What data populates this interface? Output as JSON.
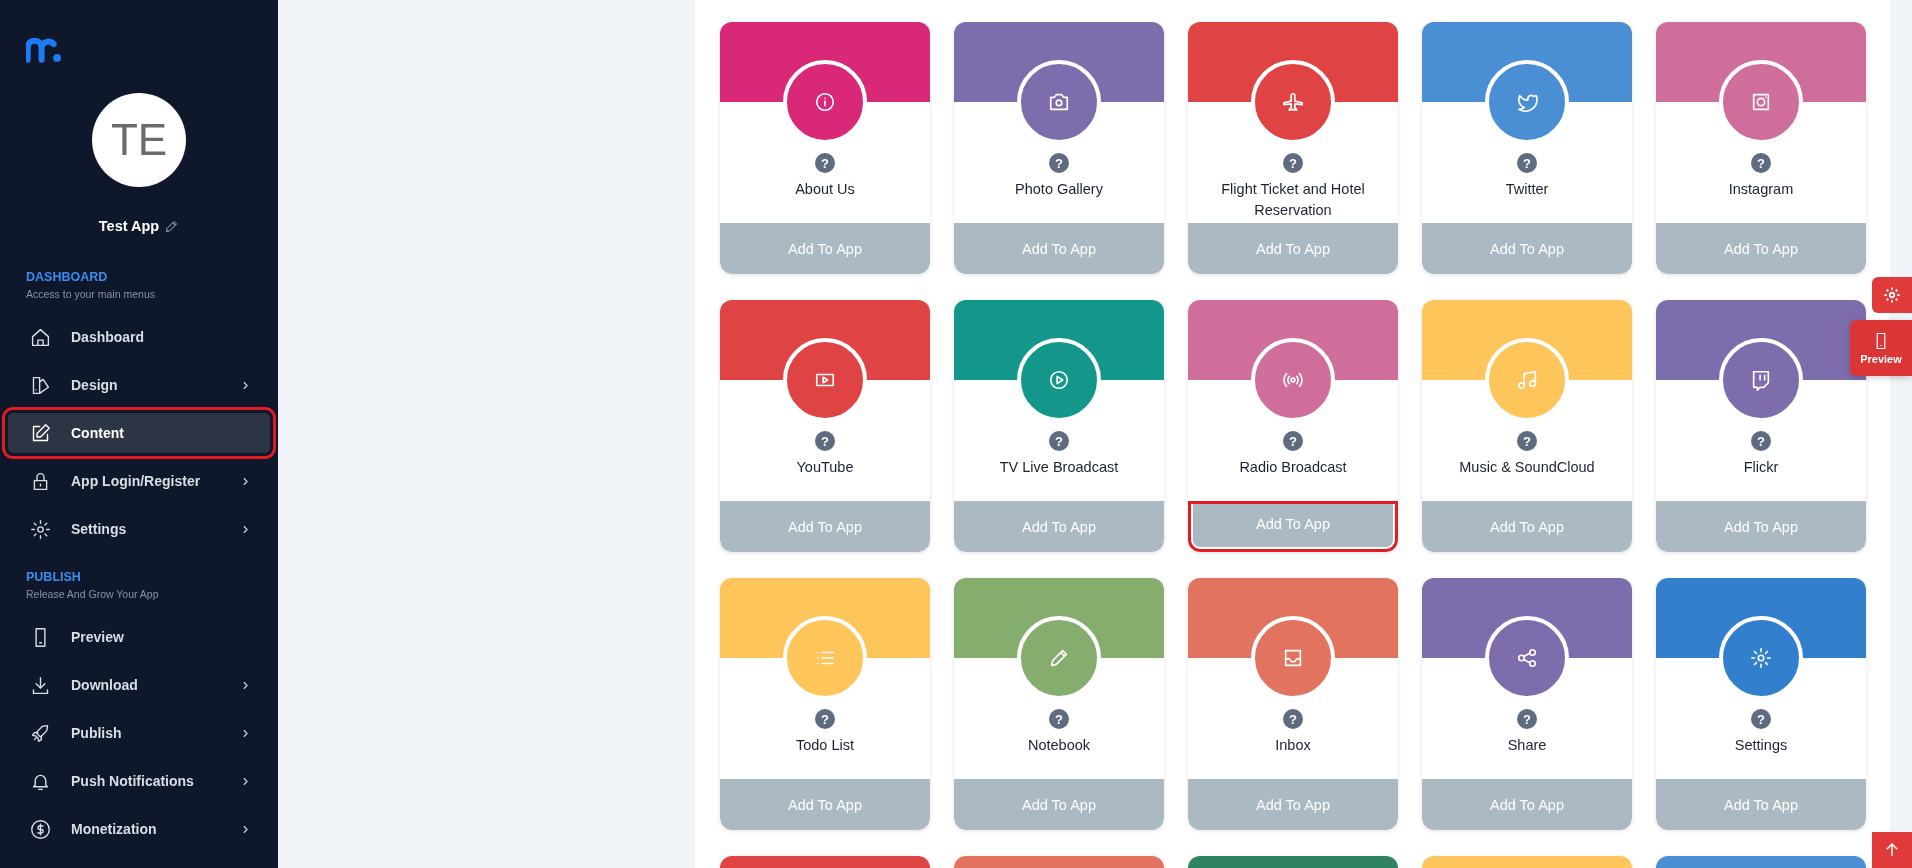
{
  "sidebar": {
    "avatar_initials": "TE",
    "app_name": "Test App",
    "sections": [
      {
        "title": "DASHBOARD",
        "subtitle": "Access to your main menus",
        "items": [
          {
            "label": "Dashboard",
            "has_submenu": false,
            "selected": false,
            "highlighted": false
          },
          {
            "label": "Design",
            "has_submenu": true,
            "selected": false,
            "highlighted": false
          },
          {
            "label": "Content",
            "has_submenu": false,
            "selected": true,
            "highlighted": true
          },
          {
            "label": "App Login/Register",
            "has_submenu": true,
            "selected": false,
            "highlighted": false
          },
          {
            "label": "Settings",
            "has_submenu": true,
            "selected": false,
            "highlighted": false
          }
        ]
      },
      {
        "title": "PUBLISH",
        "subtitle": "Release And Grow Your App",
        "items": [
          {
            "label": "Preview",
            "has_submenu": false,
            "selected": false,
            "highlighted": false
          },
          {
            "label": "Download",
            "has_submenu": true,
            "selected": false,
            "highlighted": false
          },
          {
            "label": "Publish",
            "has_submenu": true,
            "selected": false,
            "highlighted": false
          },
          {
            "label": "Push Notifications",
            "has_submenu": true,
            "selected": false,
            "highlighted": false
          },
          {
            "label": "Monetization",
            "has_submenu": true,
            "selected": false,
            "highlighted": false
          }
        ]
      }
    ]
  },
  "modules": [
    {
      "name": "About Us",
      "color": "#d92877",
      "help": "?",
      "button": "Add To App",
      "highlighted": false
    },
    {
      "name": "Photo Gallery",
      "color": "#7e6dad",
      "help": "?",
      "button": "Add To App",
      "highlighted": false
    },
    {
      "name": "Flight Ticket and Hotel Reservation",
      "color": "#e04343",
      "help": "?",
      "button": "Add To App",
      "highlighted": false
    },
    {
      "name": "Twitter",
      "color": "#4a8fd4",
      "help": "?",
      "button": "Add To App",
      "highlighted": false
    },
    {
      "name": "Instagram",
      "color": "#cf6e9b",
      "help": "?",
      "button": "Add To App",
      "highlighted": false
    },
    {
      "name": "YouTube",
      "color": "#e04343",
      "help": "?",
      "button": "Add To App",
      "highlighted": false
    },
    {
      "name": "TV Live Broadcast",
      "color": "#12978a",
      "help": "?",
      "button": "Add To App",
      "highlighted": false
    },
    {
      "name": "Radio Broadcast",
      "color": "#cf6e9b",
      "help": "?",
      "button": "Add To App",
      "highlighted": true
    },
    {
      "name": "Music & SoundCloud",
      "color": "#fdc55a",
      "help": "?",
      "button": "Add To App",
      "highlighted": false
    },
    {
      "name": "Flickr",
      "color": "#7e6dad",
      "help": "?",
      "button": "Add To App",
      "highlighted": false
    },
    {
      "name": "Todo List",
      "color": "#fdc55a",
      "help": "?",
      "button": "Add To App",
      "highlighted": false
    },
    {
      "name": "Notebook",
      "color": "#84ad6e",
      "help": "?",
      "button": "Add To App",
      "highlighted": false
    },
    {
      "name": "Inbox",
      "color": "#e2745f",
      "help": "?",
      "button": "Add To App",
      "highlighted": false
    },
    {
      "name": "Share",
      "color": "#7e6dad",
      "help": "?",
      "button": "Add To App",
      "highlighted": false
    },
    {
      "name": "Settings",
      "color": "#317fcd",
      "help": "?",
      "button": "Add To App",
      "highlighted": false
    },
    {
      "color": "#e04343"
    },
    {
      "color": "#e2745f"
    },
    {
      "color": "#2e8360"
    },
    {
      "color": "#fdc55a"
    },
    {
      "color": "#4a8fd4"
    }
  ],
  "floating": {
    "preview_label": "Preview"
  }
}
